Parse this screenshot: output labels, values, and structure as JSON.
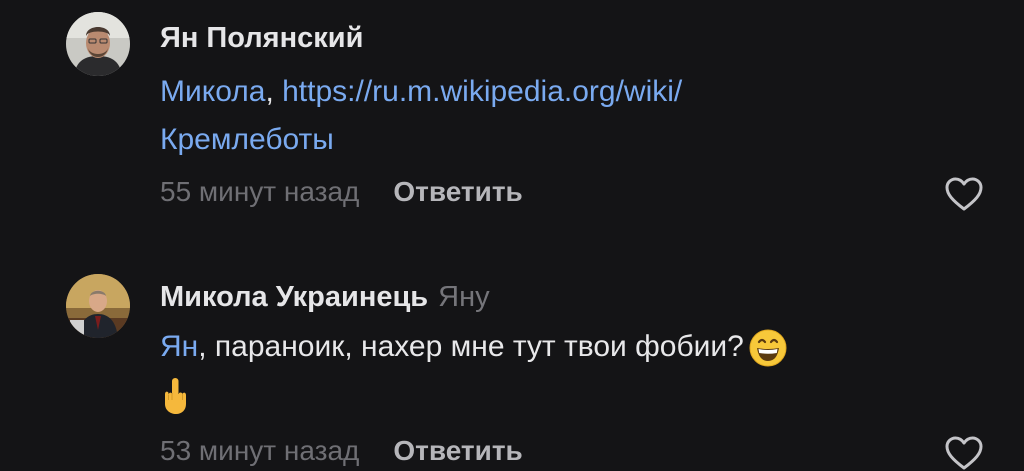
{
  "comments": [
    {
      "author": "Ян Полянский",
      "reply_to": "",
      "mention": "Микола",
      "separator": ", ",
      "link": "https://ru.m.wikipedia.org/wiki/",
      "link_cont": "Кремлеботы",
      "text": "",
      "time": "55 минут назад",
      "reply_label": "Ответить",
      "like_icon": "heart-outline-icon"
    },
    {
      "author": "Микола Украинець",
      "reply_to": "Яну",
      "mention": "Ян",
      "separator": "",
      "text": ", параноик, нахер мне тут твои фобии?",
      "emoji": "grinning-face-icon",
      "emoji2": "middle-finger-icon",
      "time": "53 минут назад",
      "reply_label": "Ответить",
      "like_icon": "heart-outline-icon"
    }
  ],
  "colors": {
    "background": "#141416",
    "link": "#7aaaf0",
    "meta": "#6f6f74"
  }
}
